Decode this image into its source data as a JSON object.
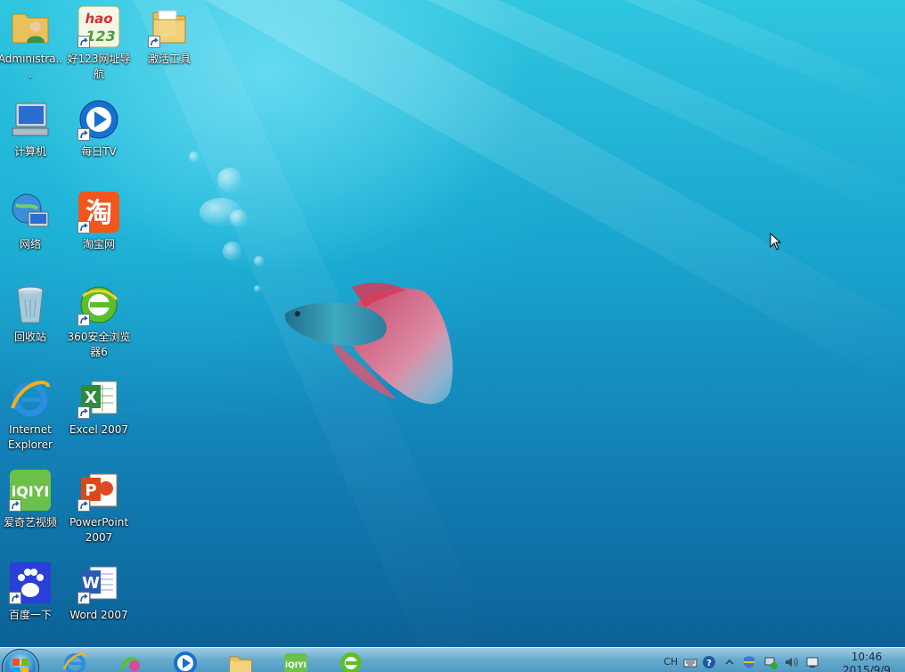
{
  "desktop_icons": [
    {
      "label": "Administra...",
      "icon": "user-folder-icon",
      "shortcut": false
    },
    {
      "label": "好123网址导航",
      "icon": "hao123-icon",
      "shortcut": true
    },
    {
      "label": "激活工具",
      "icon": "folder-icon",
      "shortcut": true
    },
    {
      "label": "计算机",
      "icon": "computer-icon",
      "shortcut": false
    },
    {
      "label": "每日TV",
      "icon": "play-tv-icon",
      "shortcut": true
    },
    {
      "label": "网络",
      "icon": "network-icon",
      "shortcut": false
    },
    {
      "label": "淘宝网",
      "icon": "taobao-icon",
      "shortcut": true
    },
    {
      "label": "回收站",
      "icon": "recycle-bin-icon",
      "shortcut": false
    },
    {
      "label": "360安全浏览器6",
      "icon": "360-browser-icon",
      "shortcut": true
    },
    {
      "label": "Internet Explorer",
      "icon": "internet-explorer-icon",
      "shortcut": false
    },
    {
      "label": "Excel 2007",
      "icon": "excel-icon",
      "shortcut": true
    },
    {
      "label": "爱奇艺视频",
      "icon": "iqiyi-icon",
      "shortcut": true
    },
    {
      "label": "PowerPoint 2007",
      "icon": "powerpoint-icon",
      "shortcut": true
    },
    {
      "label": "百度一下",
      "icon": "baidu-icon",
      "shortcut": true
    },
    {
      "label": "Word 2007",
      "icon": "word-icon",
      "shortcut": true
    }
  ],
  "taskbar": {
    "pinned": [
      "start-orb-icon",
      "internet-explorer-icon",
      "media-app-icon",
      "play-tv-icon",
      "file-explorer-icon",
      "iqiyi-icon",
      "360-browser-icon"
    ],
    "tray": {
      "ime": "CH",
      "icons": [
        "keyboard-icon",
        "help-icon",
        "show-hidden-icons-icon",
        "security-shield-icon",
        "network-tray-icon",
        "volume-icon",
        "action-center-icon"
      ]
    },
    "clock_time": "10:46",
    "clock_date": "2015/9/9"
  },
  "colors": {
    "sky_top": "#2fc6e0",
    "sea_bottom": "#0b5e93",
    "label_text": "#ffffff"
  }
}
